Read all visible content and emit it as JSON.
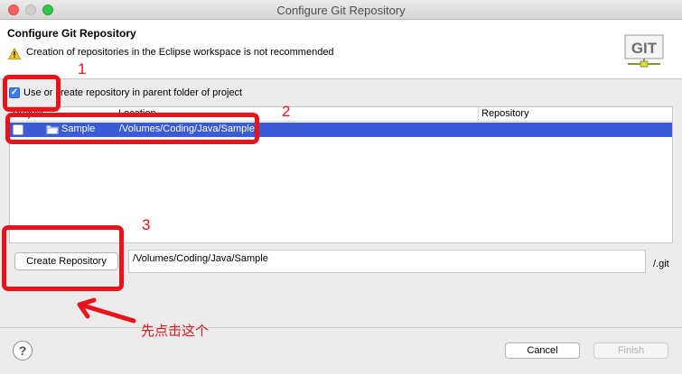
{
  "window": {
    "title": "Configure Git Repository"
  },
  "header": {
    "title": "Configure Git Repository",
    "warning": "Creation of repositories in the Eclipse workspace is not recommended",
    "logo_text": "GIT"
  },
  "options": {
    "use_parent_label": "Use or create repository in parent folder of project",
    "use_parent_checked": true
  },
  "table": {
    "columns": [
      "Project",
      "Location",
      "Repository"
    ],
    "rows": [
      {
        "project": "Sample",
        "location": "/Volumes/Coding/Java/Sample",
        "repository": "",
        "checked": false,
        "selected": true
      }
    ]
  },
  "create": {
    "button_label": "Create Repository",
    "path_value": "/Volumes/Coding/Java/Sample",
    "suffix": "/.git"
  },
  "footer": {
    "help_label": "?",
    "cancel_label": "Cancel",
    "finish_label": "Finish"
  },
  "annotations": {
    "n1": "1",
    "n2": "2",
    "n3": "3",
    "note": "先点击这个",
    "color": "#e8141b"
  },
  "colors": {
    "selection": "#3a5ad8",
    "checkbox_accent": "#3a7bf0"
  }
}
